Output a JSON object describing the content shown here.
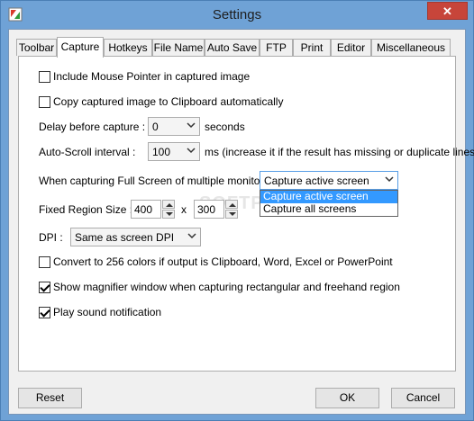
{
  "window": {
    "title": "Settings",
    "close_label": "✕"
  },
  "tabs": [
    {
      "label": "Toolbar"
    },
    {
      "label": "Capture",
      "active": true
    },
    {
      "label": "Hotkeys"
    },
    {
      "label": "File Name"
    },
    {
      "label": "Auto Save"
    },
    {
      "label": "FTP"
    },
    {
      "label": "Print"
    },
    {
      "label": "Editor"
    },
    {
      "label": "Miscellaneous"
    }
  ],
  "capture": {
    "include_pointer": {
      "label": "Include Mouse Pointer in captured image",
      "checked": false
    },
    "copy_clipboard": {
      "label": "Copy captured image to Clipboard automatically",
      "checked": false
    },
    "delay": {
      "label": "Delay before capture :",
      "value": "0",
      "unit": "seconds"
    },
    "autoscroll": {
      "label": "Auto-Scroll interval :",
      "value": "100",
      "unit": "ms (increase it if the result has missing or duplicate lines)"
    },
    "multi_monitor": {
      "label": "When capturing Full Screen of multiple monitors :",
      "value": "Capture active screen",
      "options": [
        "Capture active screen",
        "Capture all screens"
      ]
    },
    "fixed_region": {
      "label": "Fixed Region Size :",
      "width": "400",
      "sep": "x",
      "height": "300"
    },
    "dpi": {
      "label": "DPI :",
      "value": "Same as screen DPI"
    },
    "convert_256": {
      "label": "Convert to 256 colors if output is Clipboard, Word, Excel or PowerPoint",
      "checked": false
    },
    "magnifier": {
      "label": "Show magnifier window when capturing rectangular and freehand region",
      "checked": true
    },
    "sound": {
      "label": "Play sound notification",
      "checked": true
    }
  },
  "watermark": "SOFTPEDIA",
  "buttons": {
    "reset": "Reset",
    "ok": "OK",
    "cancel": "Cancel"
  }
}
